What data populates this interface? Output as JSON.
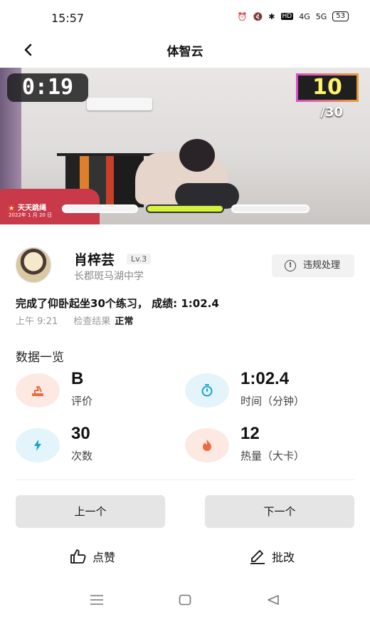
{
  "status_bar": {
    "time": "15:57",
    "icons": [
      "alarm-icon",
      "mute-icon",
      "bluetooth-icon",
      "hd-icon",
      "signal-4g-icon",
      "signal-5g-icon"
    ],
    "hd": "HD",
    "net1": "4G",
    "net2": "5G",
    "battery": "53"
  },
  "nav": {
    "title": "体智云"
  },
  "video": {
    "timer": "0:19",
    "count": "10",
    "total": "/30",
    "brand": "天天跳绳",
    "brand_date": "2022年 1 月 20 日"
  },
  "student": {
    "name": "肖梓芸",
    "level": "Lv.3",
    "school": "长郡斑马湖中学",
    "report_label": "违规处理"
  },
  "summary": {
    "text": "完成了仰卧起坐30个练习， 成绩: 1:02.4",
    "time": "上午 9:21",
    "check_label": "检查结果",
    "check_result": "正常"
  },
  "stats": {
    "title": "数据一览",
    "grade": {
      "value": "B",
      "label": "评价"
    },
    "duration": {
      "value": "1:02.4",
      "label": "时间（分钟）"
    },
    "count": {
      "value": "30",
      "label": "次数"
    },
    "calories": {
      "value": "12",
      "label": "热量（大卡）"
    }
  },
  "footer": {
    "prev_label": "上一个",
    "next_label": "下一个",
    "like_label": "点赞",
    "grade_label": "批改"
  },
  "colors": {
    "peach_bg": "#fde9e2",
    "cyan_bg": "#e3f4fb",
    "orange_icon": "#ef6a3f",
    "blue_icon": "#1aa3d9",
    "counter_text": "#fff36e",
    "progress_active": "#d6f23a"
  }
}
